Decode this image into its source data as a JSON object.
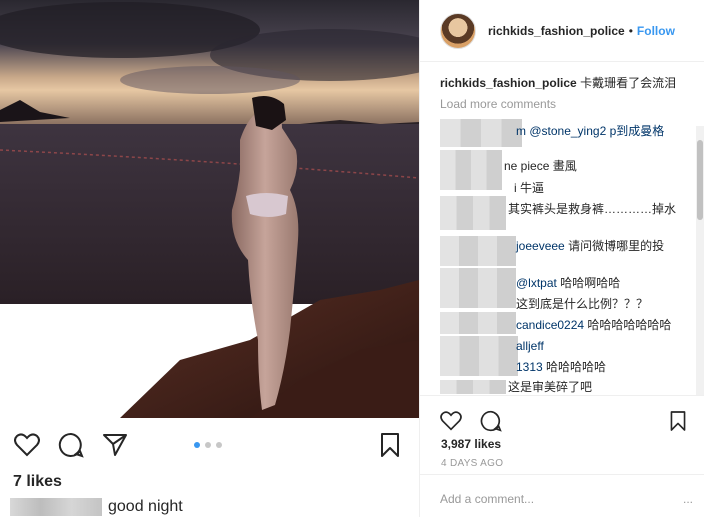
{
  "post": {
    "username": "richkids_fashion_police",
    "separator": "•",
    "follow_label": "Follow",
    "caption_text": "卡戴珊看了会流泪",
    "load_more_label": "Load more comments",
    "likes_right": "3,987 likes",
    "time_label": "4 DAYS AGO",
    "add_comment_placeholder": "Add a comment...",
    "more_label": "..."
  },
  "comments": [
    {
      "user": "m",
      "text": "@stone_ying2 p到成曼格"
    },
    {
      "user": "",
      "text": "ne piece 畫風"
    },
    {
      "user": "",
      "text": "i 牛逼"
    },
    {
      "user": "",
      "text": "其实裤头是救身裤…………掉水"
    },
    {
      "user": "joeeveee",
      "text": "请问微博哪里的投"
    },
    {
      "user": "@lxtpat",
      "text": "哈哈啊哈哈"
    },
    {
      "user": "",
      "text": "这到底是什么比例？？？"
    },
    {
      "user": "candice0224",
      "text": "哈哈哈哈哈哈哈"
    },
    {
      "user": "alljeff",
      "text": ""
    },
    {
      "user": "1313",
      "text": "哈哈哈哈哈"
    },
    {
      "user": "",
      "text": "这是审美碎了吧"
    }
  ],
  "left_panel": {
    "likes": "7 likes",
    "caption": "good night",
    "carousel_count": 3,
    "carousel_active": 1
  },
  "icons": [
    "heart-icon",
    "comment-icon",
    "share-icon",
    "bookmark-icon"
  ],
  "colors": {
    "accent": "#3897f0",
    "muted": "#999999",
    "text": "#262626"
  }
}
